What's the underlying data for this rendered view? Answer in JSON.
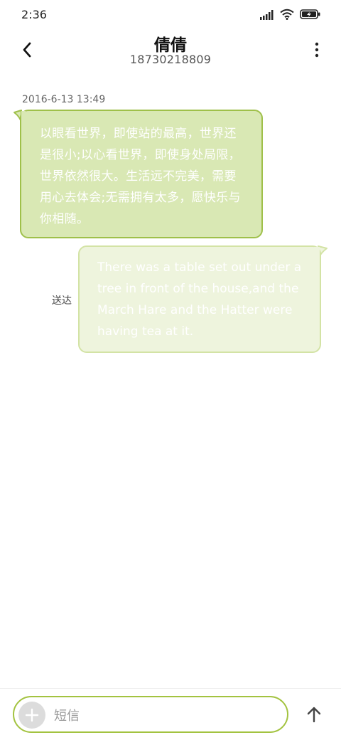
{
  "status_bar": {
    "time": "2:36",
    "icons": [
      "signal-icon",
      "wifi-icon",
      "battery-charging-icon"
    ]
  },
  "header": {
    "contact_name": "倩倩",
    "phone_number": "18730218809",
    "back_icon": "chevron-left-icon",
    "more_icon": "more-vertical-icon"
  },
  "conversation": {
    "timestamp": "2016-6-13 13:49",
    "received_message": "以眼看世界，即使站的最高，世界还是很小;以心看世界，即使身处局限，世界依然很大。生活远不完美，需要用心去体会;无需拥有太多，愿快乐与你相随。",
    "sent_message": "There was a table set out under a tree in front of the house,and the March Hare and the Hatter were having tea at it.",
    "sent_status": "送达"
  },
  "composer": {
    "placeholder": "短信",
    "add_icon": "plus-icon",
    "send_icon": "arrow-up-icon"
  },
  "colors": {
    "received_bubble_bg": "#d9e8b4",
    "received_bubble_border": "#9fc04a",
    "sent_bubble_bg": "#eef4dd",
    "sent_bubble_border": "#d3e3a5",
    "accent": "#a3c340"
  }
}
